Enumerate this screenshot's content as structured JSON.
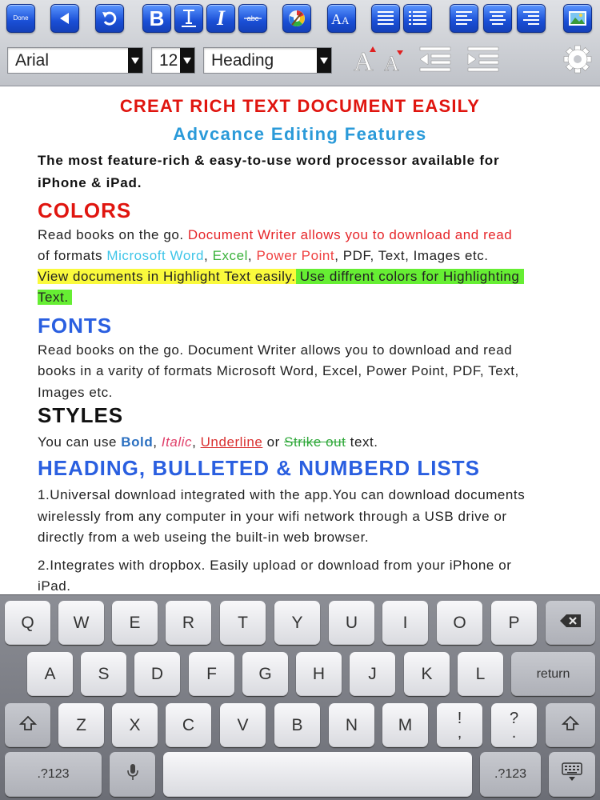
{
  "toolbar": {
    "done_label": "Done",
    "font_family": "Arial",
    "font_size": "12",
    "paragraph_style": "Heading",
    "icons": [
      "back-arrow-icon",
      "undo-icon",
      "bold-icon",
      "underline-icon",
      "italic-icon",
      "strikethrough-icon",
      "color-palette-icon",
      "font-size-icon",
      "bullet-list-icon",
      "numbered-list-icon",
      "align-left-icon",
      "align-center-icon",
      "align-right-icon",
      "insert-image-icon",
      "increase-font-icon",
      "decrease-font-icon",
      "outdent-icon",
      "indent-icon",
      "gear-icon"
    ],
    "accent_color": "#1a4fd6"
  },
  "document": {
    "title": "CREAT RICH TEXT DOCUMENT EASILY",
    "subtitle": "Advcance Editing Features",
    "intro_1": "The most feature-rich & easy-to-use word processor available for",
    "intro_2": "iPhone & iPad.",
    "colors": {
      "heading": "COLORS",
      "l1_a": "Read books on the go. ",
      "l1_b": "Document Writer allows you to download and read",
      "l2_a": "of formats ",
      "l2_b": "Microsoft Word",
      "l2_c": ", ",
      "l2_d": "Excel",
      "l2_e": ", ",
      "l2_f": "Power Point",
      "l2_g": ", PDF, Text, Images etc.",
      "l3_a": "View documents in Highlight Text easily.",
      "l3_b": " Use diffrent colors for Highlighting",
      "l4": "Text."
    },
    "fonts": {
      "heading": "FONTS",
      "l1": "Read books on the go. Document Writer allows you to download and read",
      "l2": "books in a varity of formats Microsoft Word, Excel, Power Point, PDF, Text,",
      "l3": "Images etc."
    },
    "styles": {
      "heading": "STYLES",
      "a": "You can use ",
      "bold": "Bold",
      "c1": ", ",
      "italic": "Italic",
      "c2": ", ",
      "underline": "Underline",
      "or": " or ",
      "strike": "Strike out",
      "end": " text."
    },
    "lists": {
      "heading": "HEADING, BULLETED & NUMBERD LISTS",
      "p1_l1": "1.Universal download integrated with the app.You can download documents",
      "p1_l2": "wirelessly from any computer in your wifi network through a USB drive or",
      "p1_l3": "directly from a web useing the built-in web browser.",
      "p2_l1": "2.Integrates with dropbox. Easily upload or download from your iPhone or",
      "p2_l2": "iPad."
    }
  },
  "keyboard": {
    "row1": [
      "Q",
      "W",
      "E",
      "R",
      "T",
      "Y",
      "U",
      "I",
      "O",
      "P"
    ],
    "row2": [
      "A",
      "S",
      "D",
      "F",
      "G",
      "H",
      "J",
      "K",
      "L"
    ],
    "return_label": "return",
    "row3": [
      "Z",
      "X",
      "C",
      "V",
      "B",
      "N",
      "M"
    ],
    "excl_top": "!",
    "excl_bottom": ",",
    "quest_top": "?",
    "quest_bottom": ".",
    "numbers_label": ".?123",
    "icons": [
      "backspace-icon",
      "shift-icon",
      "microphone-icon",
      "hide-keyboard-icon"
    ]
  }
}
